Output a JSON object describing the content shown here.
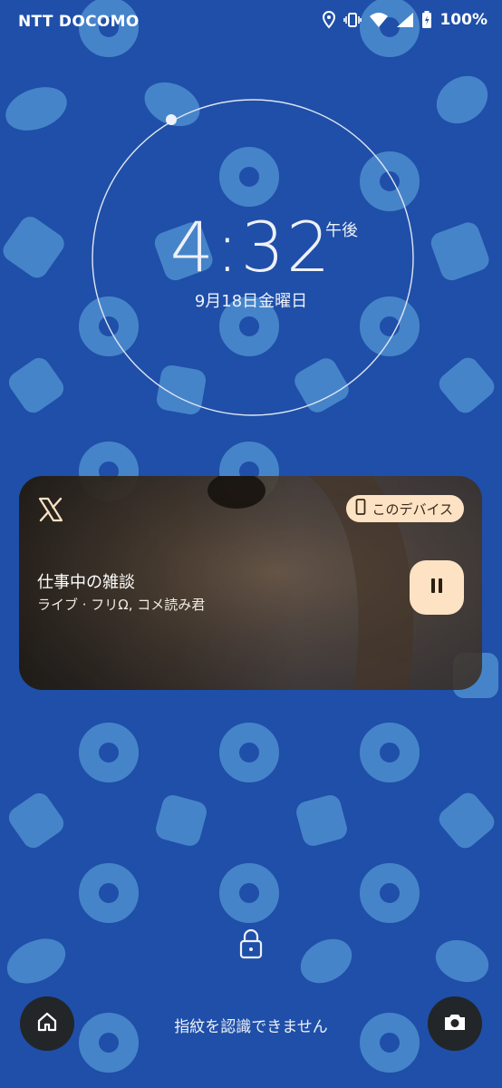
{
  "status_bar": {
    "carrier": "NTT DOCOMO",
    "battery": "100%",
    "icons": [
      "location-icon",
      "vibrate-icon",
      "wifi-icon",
      "signal-icon",
      "battery-charging-icon"
    ]
  },
  "clock": {
    "time": "4:32",
    "ampm": "午後",
    "date": "9月18日金曜日"
  },
  "media": {
    "app_icon": "x-logo-icon",
    "device_label": "このデバイス",
    "title": "仕事中の雑談",
    "subtitle": "ライブ · フリΩ, コメ読み君",
    "control": "pause-icon"
  },
  "bottom": {
    "message": "指紋を認識できません",
    "left_icon": "home-icon",
    "right_icon": "camera-icon",
    "lock_icon": "lock-icon"
  },
  "colors": {
    "wallpaper": "#1f4fa8",
    "pattern": "#4f8ed0",
    "chip": "#fde2c4",
    "button_bg": "#222629"
  }
}
